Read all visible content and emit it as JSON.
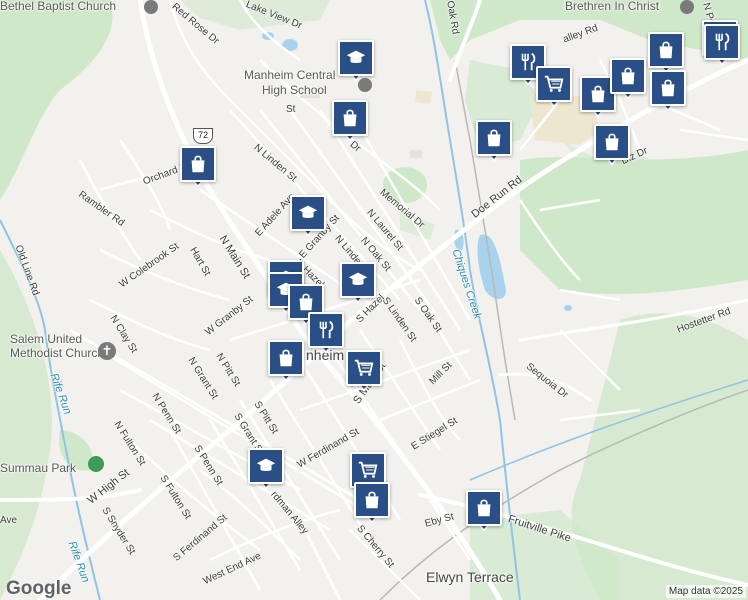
{
  "map": {
    "google_logo": "Google",
    "attribution": "Map data ©2025",
    "route_shield": "72"
  },
  "places": {
    "bethel": "Bethel Baptist Church",
    "brethren": "Brethren In Christ",
    "high_school_1": "Manheim Central",
    "high_school_2": "High School",
    "salem_1": "Salem United",
    "salem_2": "Methodist Church",
    "elwyn": "Elwyn Terrace",
    "kauffman": "Summau Park",
    "manheim": "nheim"
  },
  "streets": {
    "red_rose": "Red Rose Dr",
    "lake_view": "Lake View Dr",
    "n_linden": "N Linden St",
    "orchard": "Orchard Ln",
    "rambler": "Rambler Rd",
    "e_adele": "E Adele Ave",
    "e_granby": "E Granby St",
    "n_laurel": "N Laurel St",
    "memorial": "Memorial Dr",
    "n_oak": "N Oak St",
    "n_linden2": "N Linde",
    "doe_run": "Doe Run Rd",
    "w_colebrook": "W Colebrook St",
    "hart": "Hart St",
    "n_main": "N Main St",
    "n_hazel": "N Hazel",
    "w_granby": "W Granby St",
    "s_oak": "S Oak St",
    "s_linden": "S Linden St",
    "s_hazel": "S Hazel",
    "old_line": "Old Line Rd",
    "n_clay": "N Clay St",
    "n_pitt": "N Pitt St",
    "n_grant": "N Grant St",
    "n_penn": "N Penn St",
    "n_fulton": "N Fulton St",
    "mill": "Mill St",
    "s_main": "S Main St",
    "w_ferdinand": "W Ferdinand St",
    "s_pitt": "S Pitt St",
    "s_grant": "S Grant St",
    "s_penn": "S Penn St",
    "s_fulton": "S Fulton St",
    "s_snyder": "S Snyder St",
    "w_high": "W High St",
    "e_stiegel": "E Stiegel St",
    "s_ferdinand": "S Ferdinand St",
    "west_end": "West End Ave",
    "s_cherry": "S Cherry St",
    "eby": "Eby St",
    "fruitville": "Fruitville Pike",
    "sequoia": "Sequoia Dr",
    "hostetter": "Hostetter Rd",
    "oak_rd": "Oak Rd",
    "diz_dr": "Diz Dr",
    "penn_n": "N Pen",
    "valley_rd": "alley Rd",
    "st_short": "St",
    "ferdman": "rdman Alley",
    "pa_ln": "d",
    "ave_w": "Ave",
    "fa_dr": "Fa",
    "dr_short": "Dr",
    "a_short": "A",
    "rd_short": "Rd"
  },
  "water": {
    "chiques": "Chiques Creek",
    "rife_run_1": "Rife Run",
    "rife_run_2": "Rife Run"
  },
  "markers": [
    {
      "type": "school-icon",
      "label": "school"
    },
    {
      "type": "shopping-bag-icon",
      "label": "shop"
    },
    {
      "type": "shopping-bag-icon",
      "label": "shop"
    },
    {
      "type": "school-icon",
      "label": "school"
    },
    {
      "type": "school-icon",
      "label": "school"
    },
    {
      "type": "school-icon",
      "label": "school"
    },
    {
      "type": "school-icon",
      "label": "school"
    },
    {
      "type": "shopping-bag-icon",
      "label": "shop"
    },
    {
      "type": "restaurant-icon",
      "label": "restaurant"
    },
    {
      "type": "shopping-bag-icon",
      "label": "shop"
    },
    {
      "type": "shopping-cart-icon",
      "label": "grocery"
    },
    {
      "type": "school-icon",
      "label": "school"
    },
    {
      "type": "shopping-cart-icon",
      "label": "grocery"
    },
    {
      "type": "shopping-bag-icon",
      "label": "shop"
    },
    {
      "type": "shopping-bag-icon",
      "label": "shop"
    },
    {
      "type": "shopping-bag-icon",
      "label": "shop"
    },
    {
      "type": "restaurant-icon",
      "label": "restaurant"
    },
    {
      "type": "shopping-cart-icon",
      "label": "grocery"
    },
    {
      "type": "shopping-bag-icon",
      "label": "shop"
    },
    {
      "type": "shopping-bag-icon",
      "label": "shop"
    },
    {
      "type": "shopping-bag-icon",
      "label": "shop"
    },
    {
      "type": "shopping-bag-icon",
      "label": "shop"
    },
    {
      "type": "shopping-bag-icon",
      "label": "shop"
    },
    {
      "type": "restaurant-icon",
      "label": "restaurant"
    },
    {
      "type": "shopping-bag-icon",
      "label": "shop"
    }
  ],
  "colors": {
    "marker": "#2a4e86",
    "park": "#cfe8c9",
    "water": "#a9d3ec",
    "road": "#ffffff"
  }
}
